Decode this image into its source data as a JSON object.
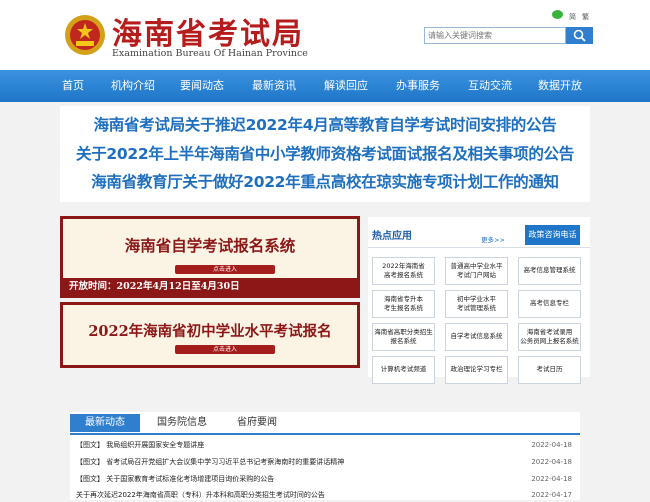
{
  "header": {
    "title_cn": "海南省考试局",
    "title_en": "Examination Bureau Of Hainan Province",
    "simplified": "简",
    "traditional": "繁",
    "search_placeholder": "请输入关键词搜索",
    "brand_color": "#b71c1c",
    "accent_color": "#2f7fce"
  },
  "nav": [
    "首页",
    "机构介绍",
    "要闻动态",
    "最新资讯",
    "解读回应",
    "办事服务",
    "互动交流",
    "数据开放"
  ],
  "headlines": [
    "海南省考试局关于推迟2022年4月高等教育自学考试时间安排的公告",
    "关于2022年上半年海南省中小学教师资格考试面试报名及相关事项的公告",
    "海南省教育厅关于做好2022年重点高校在琼实施专项计划工作的通知"
  ],
  "banners": [
    {
      "title": "海南省自学考试报名系统",
      "button": "点击进入",
      "date": "开放时间：2022年4月12日至4月30日"
    },
    {
      "title": "2022年海南省初中学业水平考试报名",
      "button": "点击进入",
      "date": ""
    }
  ],
  "apps": {
    "title": "热点应用",
    "more": "更多>>",
    "hotline": "政策咨询电话",
    "tiles": [
      "2022年海南省\n高考报名系统",
      "普通高中学业水平\n考试门户网站",
      "高考信息管理系统",
      "海南省专升本\n考生报名系统",
      "初中学业水平\n考试管理系统",
      "高考信息专栏",
      "海南省高职分类招生\n报名系统",
      "自学考试信息系统",
      "海南省考试录用\n公务员网上报名系统",
      "计算机考试频道",
      "政治理论学习专栏",
      "考试日历"
    ]
  },
  "news": {
    "tabs": [
      "最新动态",
      "国务院信息",
      "省府要闻"
    ],
    "items": [
      {
        "text": "【图文】 我局组织开展国家安全专题讲座",
        "date": "2022-04-18"
      },
      {
        "text": "【图文】 省考试局召开党组扩大会议集中学习习近平总书记考察海南时的重要讲话精神",
        "date": "2022-04-18"
      },
      {
        "text": "【图文】 关于国家教育考试标准化考场增建项目询价采购的公告",
        "date": "2022-04-18"
      },
      {
        "text": "关于再次延迟2022年海南省高职（专科）升本科和高职分类招生考试时间的公告",
        "date": "2022-04-17"
      }
    ]
  }
}
